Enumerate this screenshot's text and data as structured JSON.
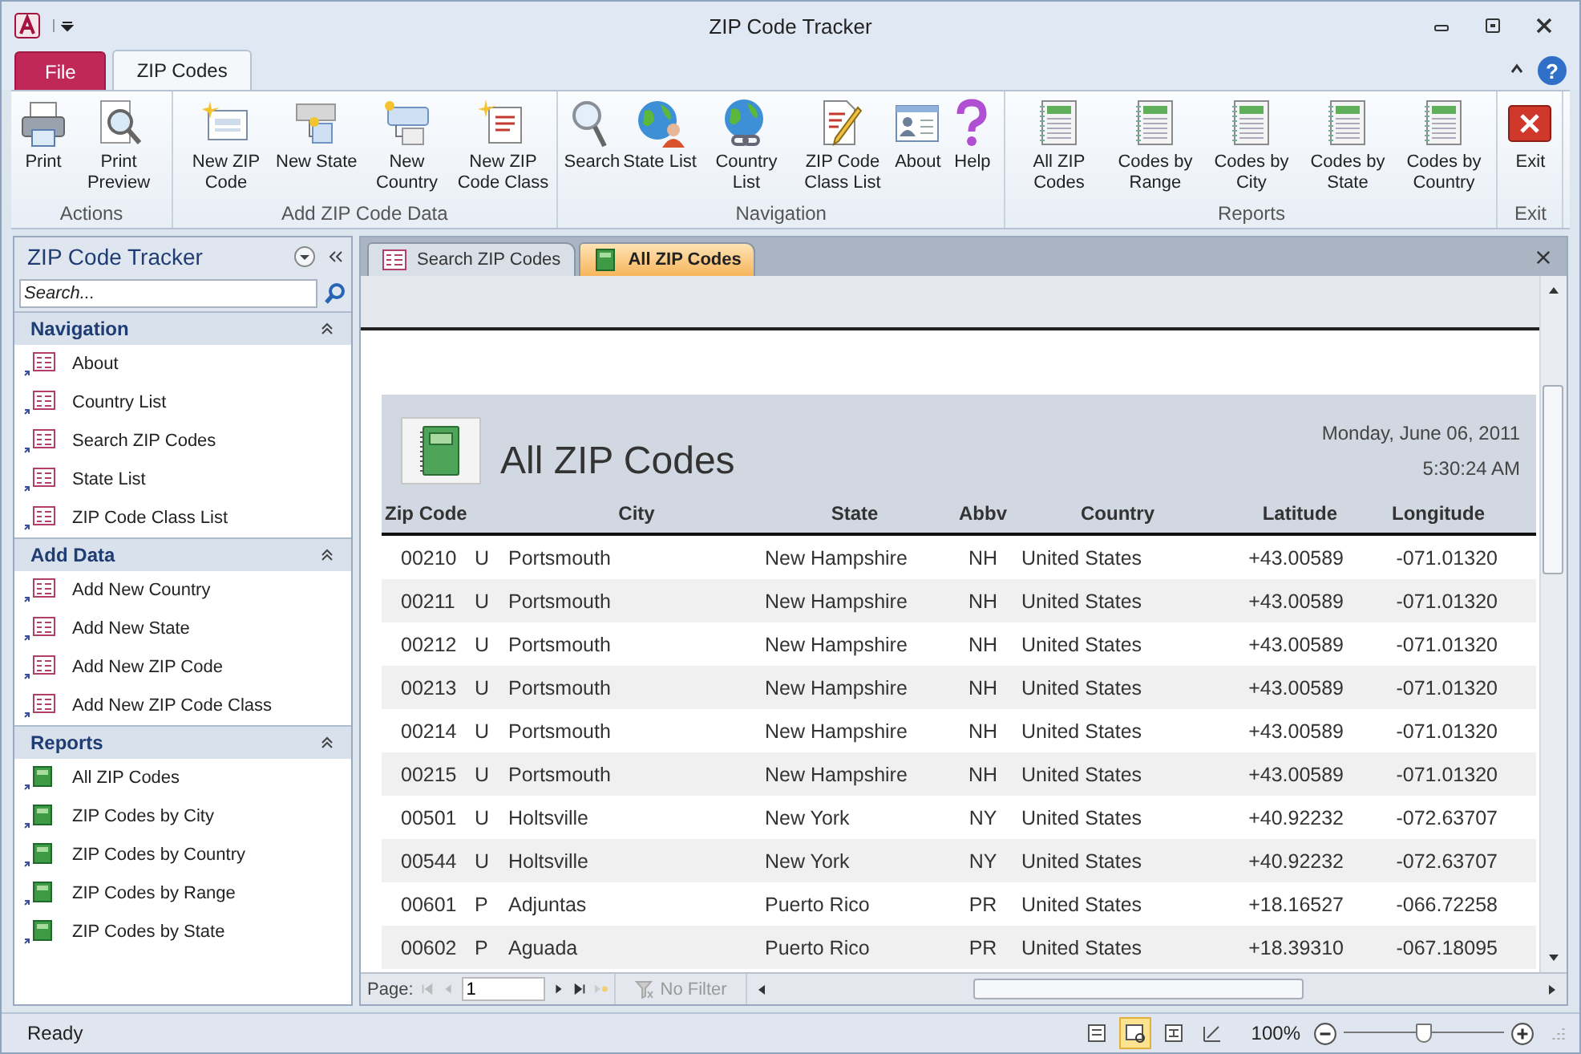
{
  "window": {
    "title": "ZIP Code Tracker",
    "help_button": "?"
  },
  "ribbon_tabs": [
    {
      "label": "File",
      "kind": "file",
      "selected": false
    },
    {
      "label": "ZIP Codes",
      "kind": "tab",
      "selected": true
    }
  ],
  "ribbon_groups": [
    {
      "label": "Actions",
      "buttons": [
        {
          "label": "Print",
          "kind": "printer"
        },
        {
          "label": "Print Preview",
          "kind": "preview"
        }
      ]
    },
    {
      "label": "Add ZIP Code Data",
      "buttons": [
        {
          "label": "New ZIP Code",
          "kind": "newform"
        },
        {
          "label": "New State",
          "kind": "newstate"
        },
        {
          "label": "New Country",
          "kind": "newcountry"
        },
        {
          "label": "New ZIP Code Class",
          "kind": "newclass"
        }
      ]
    },
    {
      "label": "Navigation",
      "buttons": [
        {
          "label": "Search",
          "kind": "search"
        },
        {
          "label": "State List",
          "kind": "globeperson"
        },
        {
          "label": "Country List",
          "kind": "globechain"
        },
        {
          "label": "ZIP Code Class List",
          "kind": "docpencil"
        },
        {
          "label": "About",
          "kind": "card"
        },
        {
          "label": "Help",
          "kind": "help"
        }
      ]
    },
    {
      "label": "Reports",
      "buttons": [
        {
          "label": "All ZIP Codes",
          "kind": "report"
        },
        {
          "label": "Codes by Range",
          "kind": "report"
        },
        {
          "label": "Codes by City",
          "kind": "report"
        },
        {
          "label": "Codes by State",
          "kind": "report"
        },
        {
          "label": "Codes by Country",
          "kind": "report"
        }
      ]
    },
    {
      "label": "Exit",
      "buttons": [
        {
          "label": "Exit",
          "kind": "exit"
        }
      ]
    }
  ],
  "nav_pane": {
    "title": "ZIP Code Tracker",
    "search": {
      "placeholder": "Search..."
    },
    "groups": [
      {
        "label": "Navigation",
        "expanded": true,
        "items": [
          {
            "label": "About",
            "kind": "form"
          },
          {
            "label": "Country List",
            "kind": "form"
          },
          {
            "label": "Search ZIP Codes",
            "kind": "form"
          },
          {
            "label": "State List",
            "kind": "form"
          },
          {
            "label": "ZIP Code Class List",
            "kind": "form"
          }
        ]
      },
      {
        "label": "Add Data",
        "expanded": true,
        "items": [
          {
            "label": "Add New Country",
            "kind": "form"
          },
          {
            "label": "Add New State",
            "kind": "form"
          },
          {
            "label": "Add New ZIP Code",
            "kind": "form"
          },
          {
            "label": "Add New ZIP Code Class",
            "kind": "form"
          }
        ]
      },
      {
        "label": "Reports",
        "expanded": true,
        "items": [
          {
            "label": "All ZIP Codes",
            "kind": "report"
          },
          {
            "label": "ZIP Codes by City",
            "kind": "report"
          },
          {
            "label": "ZIP Codes by Country",
            "kind": "report"
          },
          {
            "label": "ZIP Codes by Range",
            "kind": "report"
          },
          {
            "label": "ZIP Codes by State",
            "kind": "report"
          }
        ]
      }
    ]
  },
  "document_tabs": [
    {
      "label": "Search ZIP Codes",
      "kind": "form",
      "selected": false
    },
    {
      "label": "All ZIP Codes",
      "kind": "report",
      "selected": true
    }
  ],
  "report": {
    "title": "All ZIP Codes",
    "date": "Monday, June 06, 2011",
    "time": "5:30:24 AM",
    "columns": [
      "Zip Code",
      "",
      "City",
      "State",
      "Abbv",
      "Country",
      "Latitude",
      "Longitude"
    ],
    "rows": [
      [
        "00210",
        "U",
        "Portsmouth",
        "New Hampshire",
        "NH",
        "United States",
        "+43.00589",
        "-071.01320"
      ],
      [
        "00211",
        "U",
        "Portsmouth",
        "New Hampshire",
        "NH",
        "United States",
        "+43.00589",
        "-071.01320"
      ],
      [
        "00212",
        "U",
        "Portsmouth",
        "New Hampshire",
        "NH",
        "United States",
        "+43.00589",
        "-071.01320"
      ],
      [
        "00213",
        "U",
        "Portsmouth",
        "New Hampshire",
        "NH",
        "United States",
        "+43.00589",
        "-071.01320"
      ],
      [
        "00214",
        "U",
        "Portsmouth",
        "New Hampshire",
        "NH",
        "United States",
        "+43.00589",
        "-071.01320"
      ],
      [
        "00215",
        "U",
        "Portsmouth",
        "New Hampshire",
        "NH",
        "United States",
        "+43.00589",
        "-071.01320"
      ],
      [
        "00501",
        "U",
        "Holtsville",
        "New York",
        "NY",
        "United States",
        "+40.92232",
        "-072.63707"
      ],
      [
        "00544",
        "U",
        "Holtsville",
        "New York",
        "NY",
        "United States",
        "+40.92232",
        "-072.63707"
      ],
      [
        "00601",
        "P",
        "Adjuntas",
        "Puerto Rico",
        "PR",
        "United States",
        "+18.16527",
        "-066.72258"
      ],
      [
        "00602",
        "P",
        "Aguada",
        "Puerto Rico",
        "PR",
        "United States",
        "+18.39310",
        "-067.18095"
      ]
    ]
  },
  "page_nav": {
    "label": "Page:",
    "value": "1",
    "filter": "No Filter"
  },
  "status_bar": {
    "text": "Ready",
    "views": [
      {
        "kind": "report",
        "selected": false
      },
      {
        "kind": "layout",
        "selected": true
      },
      {
        "kind": "design",
        "selected": false
      },
      {
        "kind": "print",
        "selected": false
      }
    ],
    "zoom": "100%",
    "zoom_slider": {
      "level": 0.5
    }
  }
}
